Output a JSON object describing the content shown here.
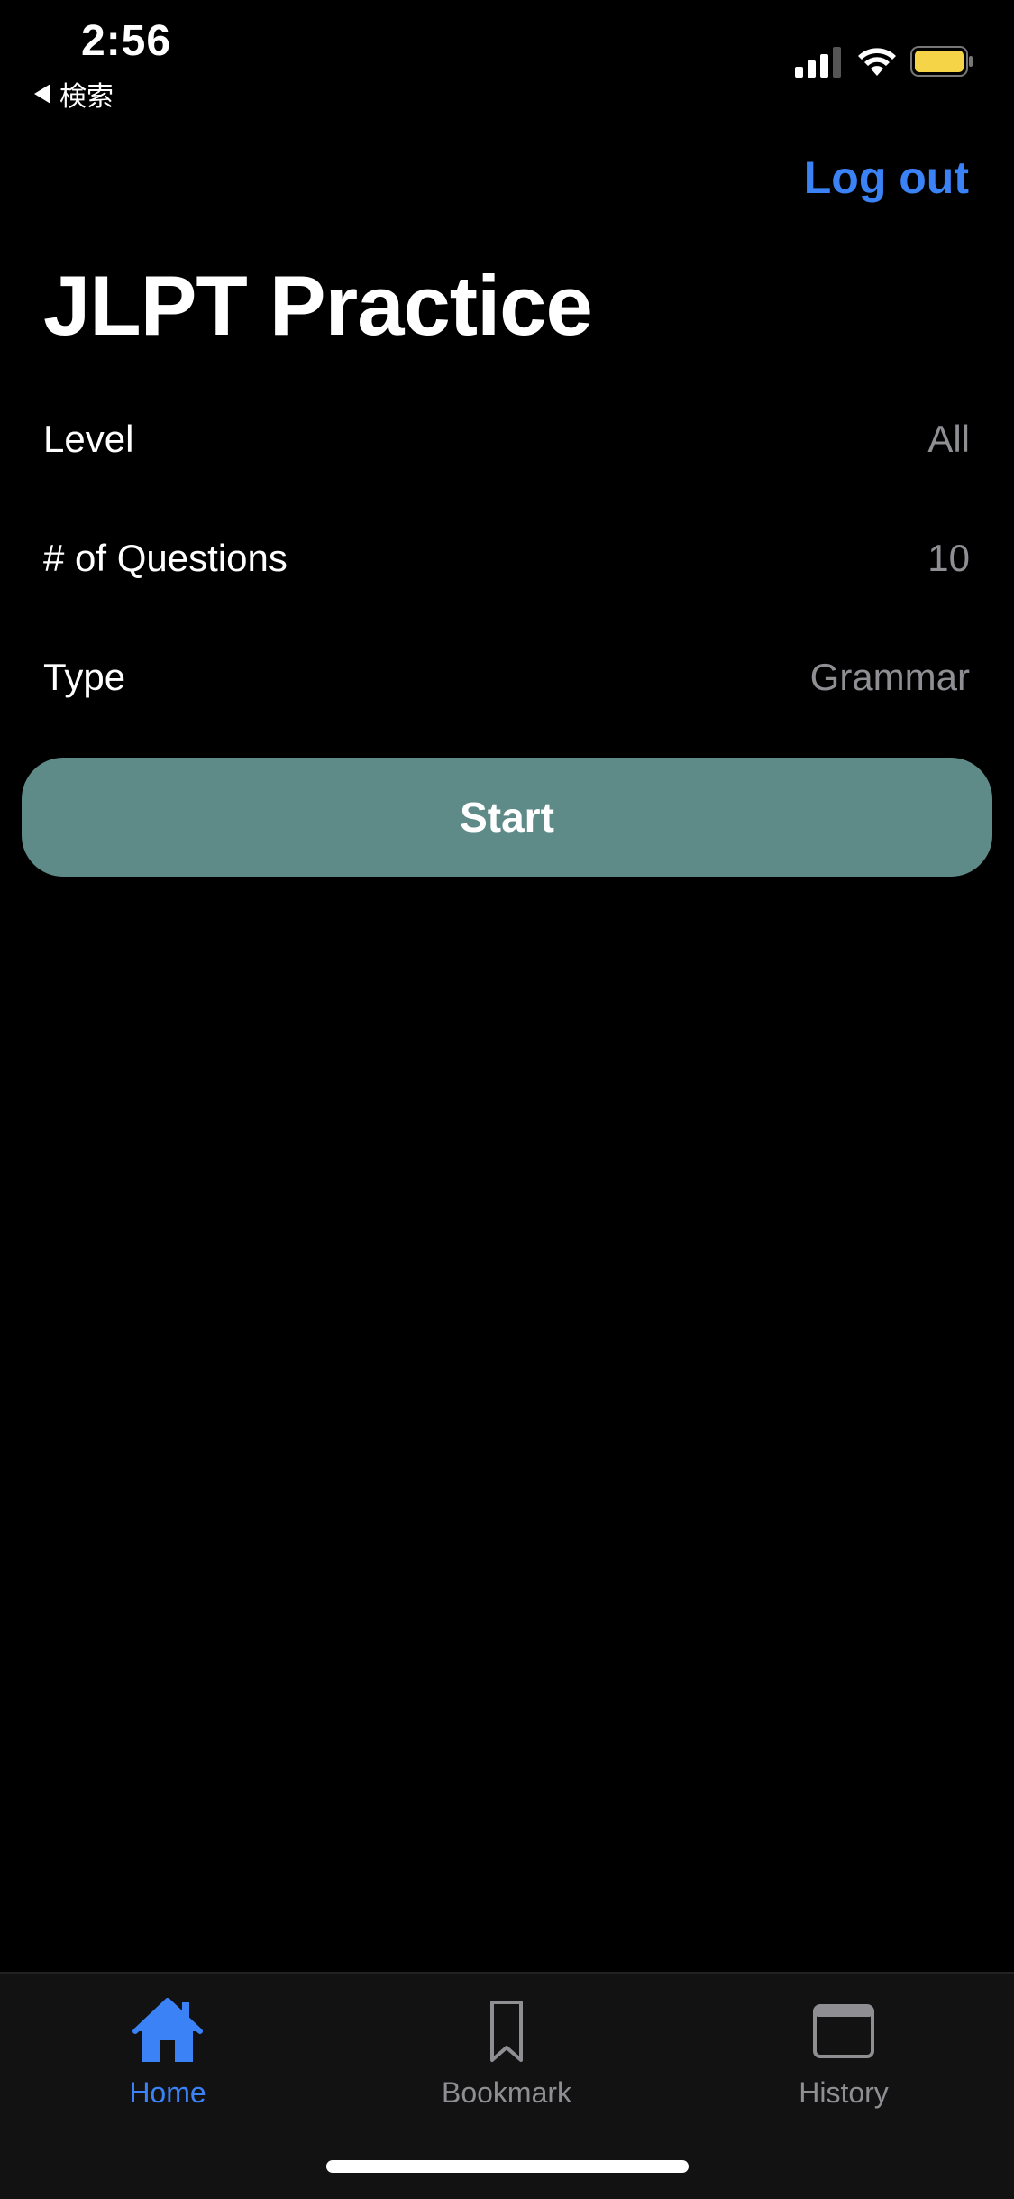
{
  "status_bar": {
    "time": "2:56",
    "back_label": "検索"
  },
  "header": {
    "logout_label": "Log out",
    "title": "JLPT Practice"
  },
  "settings": [
    {
      "label": "Level",
      "value": "All"
    },
    {
      "label": "# of Questions",
      "value": "10"
    },
    {
      "label": "Type",
      "value": "Grammar"
    }
  ],
  "start_label": "Start",
  "tabs": [
    {
      "label": "Home",
      "icon": "home-icon",
      "active": true
    },
    {
      "label": "Bookmark",
      "icon": "bookmark-icon",
      "active": false
    },
    {
      "label": "History",
      "icon": "history-icon",
      "active": false
    }
  ],
  "colors": {
    "accent": "#3b82f6",
    "start_button": "#5e8b87",
    "battery": "#f5d547"
  }
}
